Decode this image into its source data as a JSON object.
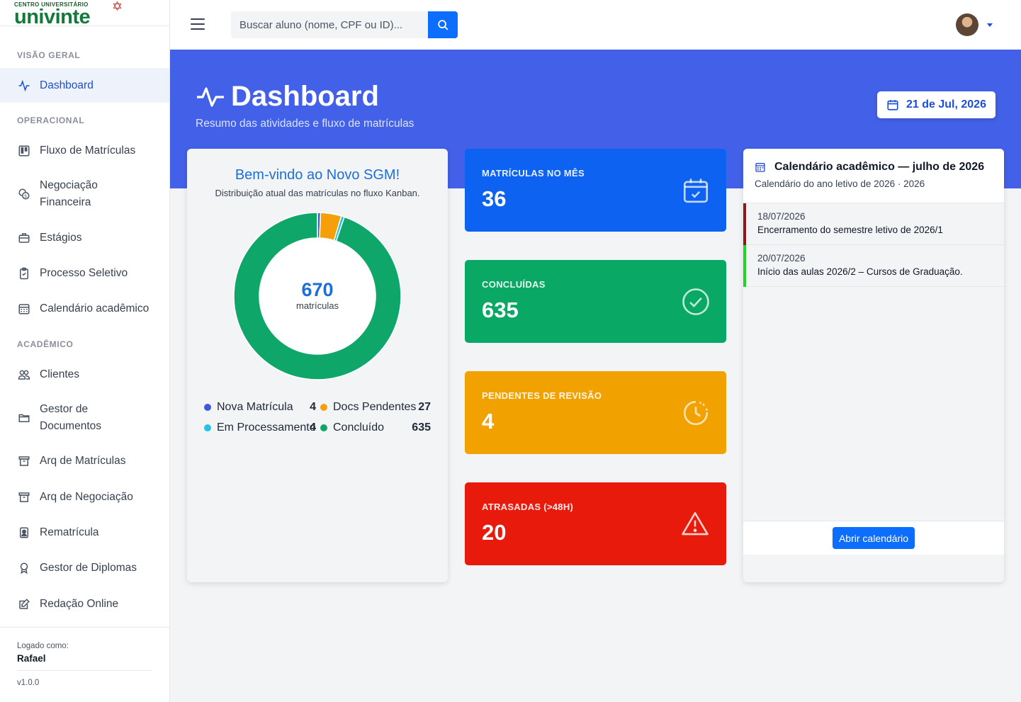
{
  "brand": {
    "small": "CENTRO UNIVERSITÁRIO",
    "name": "univinte"
  },
  "sidebar": {
    "sections": [
      {
        "title": "VISÃO GERAL"
      },
      {
        "title": "OPERACIONAL"
      },
      {
        "title": "ACADÊMICO"
      }
    ],
    "items": [
      {
        "label": "Dashboard",
        "icon": "activity-icon"
      },
      {
        "label": "Fluxo de Matrículas",
        "icon": "kanban-icon"
      },
      {
        "label": "Negociação Financeira",
        "icon": "coins-icon"
      },
      {
        "label": "Estágios",
        "icon": "briefcase-icon"
      },
      {
        "label": "Processo Seletivo",
        "icon": "clipboard-check-icon"
      },
      {
        "label": "Calendário acadêmico",
        "icon": "calendar-grid-icon"
      },
      {
        "label": "Clientes",
        "icon": "people-icon"
      },
      {
        "label": "Gestor de Documentos",
        "icon": "folder-icon"
      },
      {
        "label": "Arq de Matrículas",
        "icon": "archive-icon"
      },
      {
        "label": "Arq de Negociação",
        "icon": "archive-icon"
      },
      {
        "label": "Rematrícula",
        "icon": "person-badge-icon"
      },
      {
        "label": "Gestor de Diplomas",
        "icon": "award-icon"
      },
      {
        "label": "Redação Online",
        "icon": "pencil-square-icon"
      }
    ],
    "footer": {
      "logged_label": "Logado como:",
      "user": "Rafael",
      "version": "v1.0.0"
    }
  },
  "topbar": {
    "search_placeholder": "Buscar aluno (nome, CPF ou ID)..."
  },
  "hero": {
    "title": "Dashboard",
    "subtitle": "Resumo das atividades e fluxo de matrículas",
    "date": "21 de Jul, 2026"
  },
  "welcome": {
    "title": "Bem-vindo ao Novo SGM!",
    "subtitle": "Distribuição atual das matrículas no fluxo Kanban.",
    "total": "670",
    "total_label": "matrículas"
  },
  "chart_data": {
    "type": "pie",
    "categories": [
      "Nova Matrícula",
      "Docs Pendentes",
      "Em Processamento",
      "Concluído"
    ],
    "values": [
      4,
      27,
      4,
      635
    ],
    "colors": [
      "#3b5bdb",
      "#f59f0b",
      "#22c3e6",
      "#0fa66a"
    ],
    "legend_values": [
      "4",
      "27",
      "4",
      "635"
    ]
  },
  "stats": [
    {
      "label": "MATRÍCULAS NO MÊS",
      "value": "36",
      "color": "#0d62f2",
      "icon": "calendar-check-icon"
    },
    {
      "label": "CONCLUÍDAS",
      "value": "635",
      "color": "#0aa865",
      "icon": "check-circle-icon"
    },
    {
      "label": "PENDENTES DE REVISÃO",
      "value": "4",
      "color": "#f2a200",
      "icon": "clock-icon"
    },
    {
      "label": "ATRASADAS (>48H)",
      "value": "20",
      "color": "#e81a0c",
      "icon": "warning-icon"
    }
  ],
  "calendar": {
    "title": "Calendário acadêmico — julho de 2026",
    "subtitle": "Calendário do ano letivo de 2026 · 2026",
    "events": [
      {
        "date": "18/07/2026",
        "desc": "Encerramento do semestre letivo de 2026/1",
        "color": "#8b1a1a"
      },
      {
        "date": "20/07/2026",
        "desc": "Início das aulas 2026/2 – Cursos de Graduação.",
        "color": "#22d32a"
      }
    ],
    "button": "Abrir calendário"
  }
}
